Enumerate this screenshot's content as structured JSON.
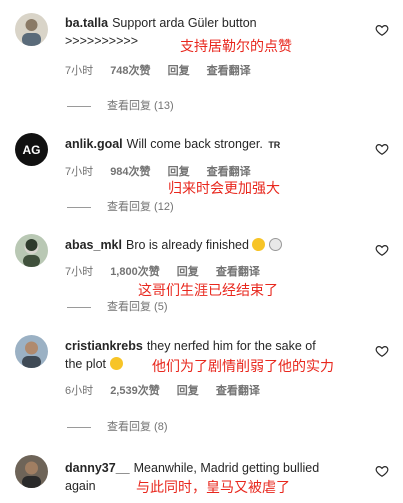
{
  "comments": [
    {
      "username": "ba.talla",
      "text": "Support arda Güler button",
      "text_line2": ">>>>>>>>>>",
      "translation": "支持居勒尔的点赞",
      "time": "7小时",
      "likes": "748次赞",
      "reply": "回复",
      "translate": "查看翻译",
      "view_replies": "查看回复 (13)"
    },
    {
      "username": "anlik.goal",
      "text": "Will come back stronger.",
      "suffix": "TR",
      "translation": "归来时会更加强大",
      "time": "7小时",
      "likes": "984次赞",
      "reply": "回复",
      "translate": "查看翻译",
      "view_replies": "查看回复 (12)"
    },
    {
      "username": "abas_mkl",
      "text": "Bro is already finished",
      "translation": "这哥们生涯已经结束了",
      "time": "7小时",
      "likes": "1,800次赞",
      "reply": "回复",
      "translate": "查看翻译",
      "view_replies": "查看回复 (5)"
    },
    {
      "username": "cristiankrebs",
      "text": "they nerfed him for the sake of",
      "text_line2": "the plot",
      "translation": "他们为了剧情削弱了他的实力",
      "time": "6小时",
      "likes": "2,539次赞",
      "reply": "回复",
      "translate": "查看翻译",
      "view_replies": "查看回复 (8)"
    },
    {
      "username": "danny37__",
      "text": "Meanwhile, Madrid getting bullied",
      "text_line2": "again",
      "translation": "与此同时，皇马又被虐了"
    }
  ],
  "icons": {
    "like": "heart-outline-icon"
  },
  "colors": {
    "translation": "#e8271d",
    "meta": "#737373"
  }
}
